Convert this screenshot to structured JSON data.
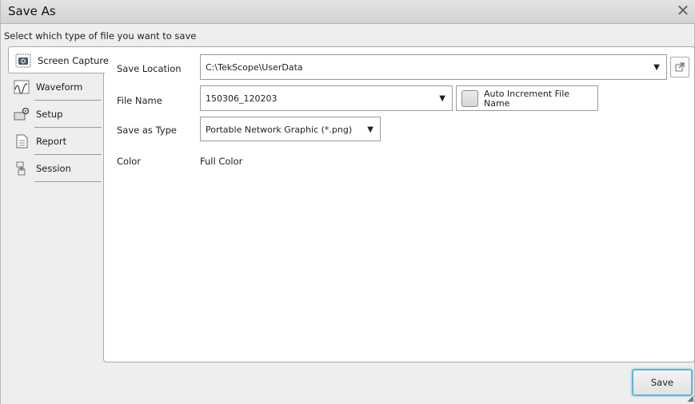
{
  "window": {
    "title": "Save As",
    "close_icon": "close-icon"
  },
  "subtitle": "Select which type of file you want to save",
  "tabs": [
    {
      "label": "Screen Capture",
      "icon": "camera-icon",
      "active": true
    },
    {
      "label": "Waveform",
      "icon": "waveform-icon",
      "active": false
    },
    {
      "label": "Setup",
      "icon": "setup-icon",
      "active": false
    },
    {
      "label": "Report",
      "icon": "document-icon",
      "active": false
    },
    {
      "label": "Session",
      "icon": "session-icon",
      "active": false
    }
  ],
  "form": {
    "save_location": {
      "label": "Save Location",
      "value": "C:\\TekScope\\UserData"
    },
    "file_name": {
      "label": "File Name",
      "value": "150306_120203"
    },
    "auto_increment": {
      "label": "Auto Increment File Name",
      "checked": false
    },
    "save_as_type": {
      "label": "Save as Type",
      "value": "Portable Network Graphic (*.png)"
    },
    "color": {
      "label": "Color",
      "value": "Full Color"
    }
  },
  "buttons": {
    "save": "Save"
  },
  "colors": {
    "accent": "#5fb6d6",
    "panel": "#ffffff",
    "background": "#eeeeee"
  }
}
